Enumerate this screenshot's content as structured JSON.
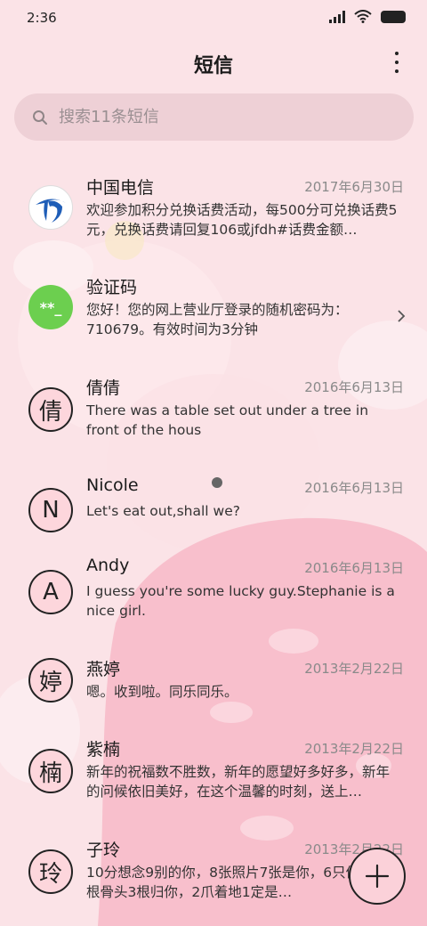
{
  "status": {
    "time": "2:36"
  },
  "header": {
    "title": "短信"
  },
  "search": {
    "placeholder": "搜索11条短信"
  },
  "conversations": [
    {
      "name": "中国电信",
      "date": "2017年6月30日",
      "message": "欢迎参加积分兑换话费活动，每500分可兑换话费5元，兑换话费请回复106或jfdh#话费金额…",
      "avatar_icon": "china-telecom-logo-icon"
    },
    {
      "name": "验证码",
      "date": "",
      "message": "您好！您的网上营业厅登录的随机密码为：710679。有效时间为3分钟",
      "avatar_text": "**_"
    },
    {
      "name": "倩倩",
      "date": "2016年6月13日",
      "message": "There was a table set out under a tree in front of the hous",
      "avatar_text": "倩"
    },
    {
      "name": "Nicole",
      "date": "2016年6月13日",
      "message": "Let's eat out,shall we?",
      "avatar_text": "N"
    },
    {
      "name": "Andy",
      "date": "2016年6月13日",
      "message": "I guess you're some lucky guy.Stephanie is a nice girl.",
      "avatar_text": "A"
    },
    {
      "name": "燕婷",
      "date": "2013年2月22日",
      "message": "嗯。收到啦。同乐同乐。",
      "avatar_text": "婷"
    },
    {
      "name": "紫楠",
      "date": "2013年2月22日",
      "message": "新年的祝福数不胜数，新年的愿望好多好多，新年的问候依旧美好，在这个温馨的时刻，送上…",
      "avatar_text": "楠"
    },
    {
      "name": "子玲",
      "date": "2013年2月22日",
      "message": "10分想念9别的你，8张照片7张是你，6只像你，4根骨头3根归你，2爪着地1定是…",
      "avatar_text": "玲"
    }
  ],
  "colors": {
    "background": "#fbe3e7",
    "verification_avatar": "#6ccf4f",
    "telecom_blue": "#1e5db7",
    "fab": "#fbd1d9"
  }
}
